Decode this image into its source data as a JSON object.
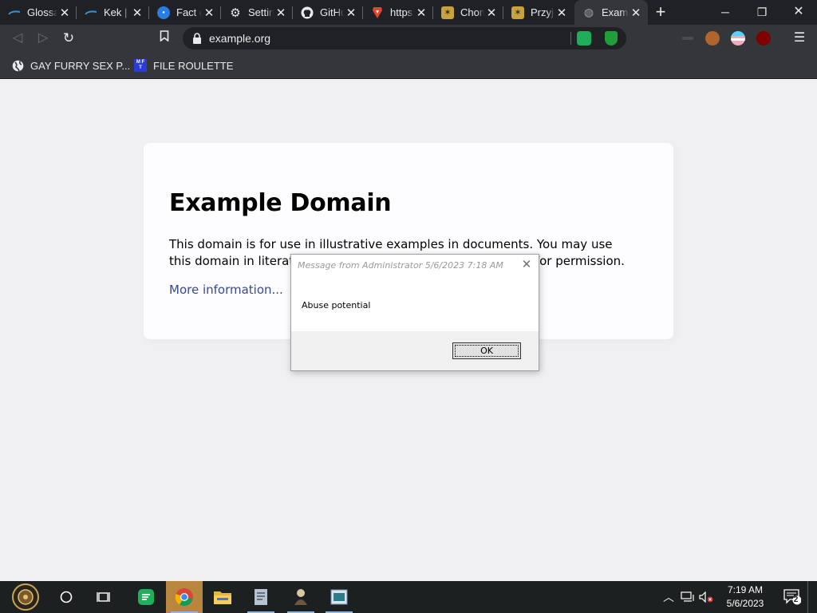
{
  "browser": {
    "tabs": [
      {
        "title": "Glossary",
        "icon": "glossary-favicon"
      },
      {
        "title": "Kek | ",
        "icon": "kek-favicon"
      },
      {
        "title": "Fact c",
        "icon": "fact-favicon"
      },
      {
        "title": "Settings",
        "icon": "gear-icon"
      },
      {
        "title": "GitHub",
        "icon": "github-icon"
      },
      {
        "title": "https:",
        "icon": "brave-icon"
      },
      {
        "title": "Chomi",
        "icon": "chomi-favicon"
      },
      {
        "title": "Przyjo",
        "icon": "przyjo-favicon"
      },
      {
        "title": "Examp",
        "icon": "globe-icon",
        "active": true
      }
    ],
    "url": "example.org",
    "bookmarks": [
      {
        "label": "GAY FURRY SEX P...",
        "icon": "globe-icon"
      },
      {
        "label": "FILE ROULETTE",
        "icon": "mft-icon"
      }
    ],
    "accent": "#35363a"
  },
  "page": {
    "heading": "Example Domain",
    "body": "This domain is for use in illustrative examples in documents. You may use this domain in literature without prior coordination or asking for permission.",
    "link": "More information..."
  },
  "dialog": {
    "title": "Message from Administrator 5/6/2023 7:18 AM",
    "message": "Abuse potential",
    "ok_label": "OK"
  },
  "taskbar": {
    "time": "7:19 AM",
    "date": "5/6/2023",
    "notification_count": "2"
  }
}
